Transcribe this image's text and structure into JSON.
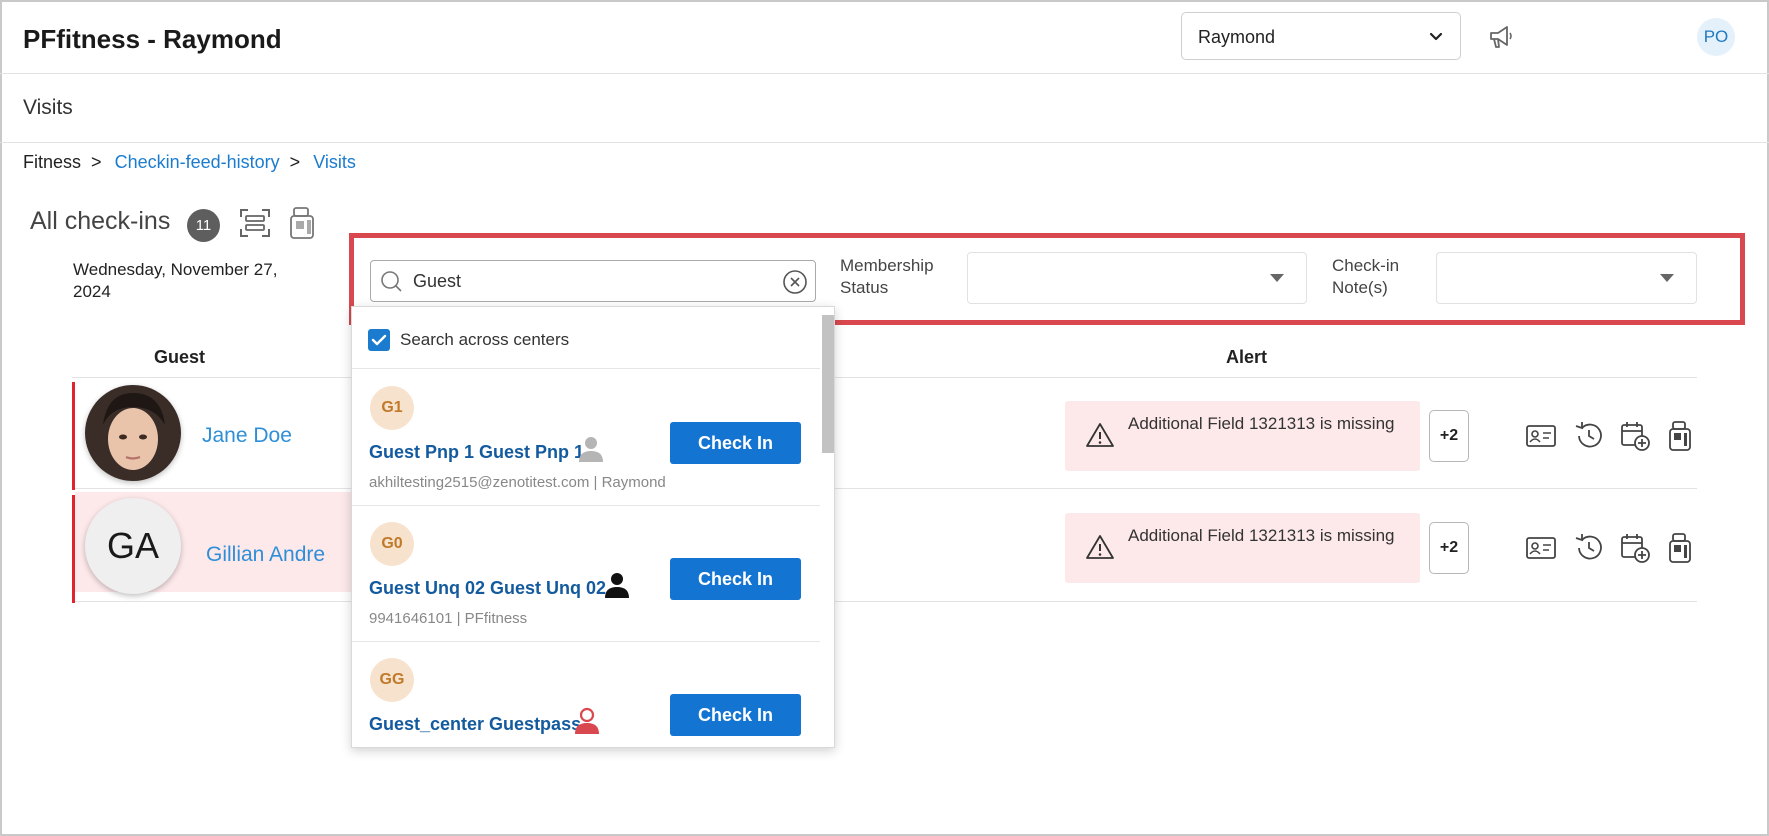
{
  "app": {
    "title": "PFfitness - Raymond",
    "user_initials": "PO",
    "icons": {
      "megaphone": "megaphone-icon"
    }
  },
  "center_selector": {
    "value": "Raymond"
  },
  "page": {
    "title": "Visits"
  },
  "breadcrumb": {
    "root": "Fitness",
    "sep1": ">",
    "link1": "Checkin-feed-history",
    "sep2": ">",
    "link2": "Visits"
  },
  "checkins": {
    "title": "All check-ins",
    "count": "11",
    "date": "Wednesday, November 27, 2024"
  },
  "filters": {
    "search_value": "Guest",
    "membership_label": "Membership Status",
    "membership_value": "",
    "note_label": "Check-in Note(s)",
    "note_value": ""
  },
  "columns": {
    "guest": "Guest",
    "alert": "Alert"
  },
  "rows": [
    {
      "name": "Jane Doe",
      "alert": "Additional Field 1321313 is missing",
      "more": "+2"
    },
    {
      "name": "Gillian Andre",
      "initials": "GA",
      "alert": "Additional Field 1321313 is missing",
      "more": "+2"
    }
  ],
  "dropdown": {
    "search_across_label": "Search across centers",
    "search_across_checked": true,
    "items": [
      {
        "initials": "G1",
        "name": "Guest Pnp 1 Guest Pnp 1",
        "meta": "akhiltesting2515@zenotitest.com  |  Raymond",
        "button": "Check In",
        "person_color": "#b5b5b5"
      },
      {
        "initials": "G0",
        "name": "Guest Unq 02 Guest Unq 02",
        "meta": "9941646101  |  PFfitness",
        "button": "Check In",
        "person_color": "#111111"
      },
      {
        "initials": "GG",
        "name": "Guest_center Guestpass",
        "meta": "",
        "button": "Check In",
        "person_color": "#d9484f"
      }
    ]
  },
  "colors": {
    "accent": "#1b7ccf",
    "button": "#1474d2",
    "alert_bg": "#fde8ea",
    "highlight": "#d9484f",
    "guest_link": "#2e8fd8"
  }
}
